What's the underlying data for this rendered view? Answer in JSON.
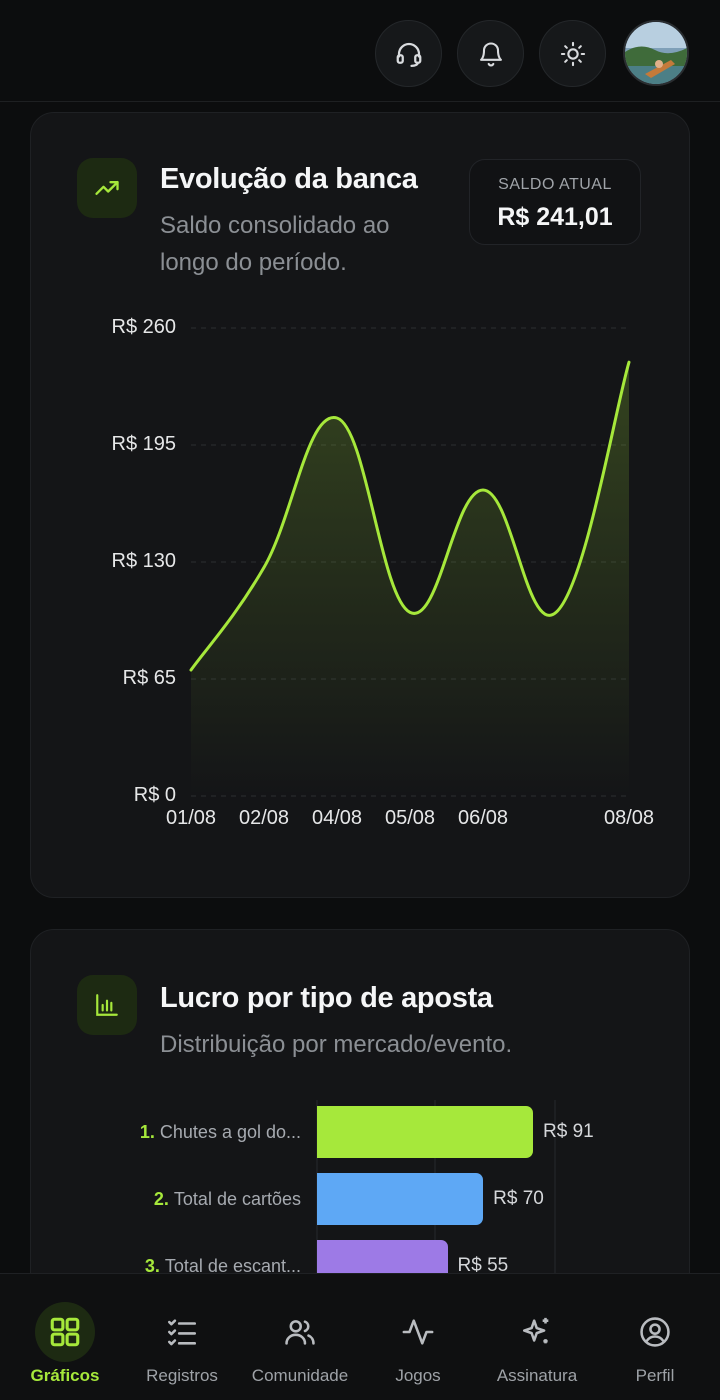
{
  "header": {
    "buttons": [
      {
        "icon": "headset-icon"
      },
      {
        "icon": "bell-icon"
      },
      {
        "icon": "sun-icon"
      }
    ],
    "avatar_icon": "avatar"
  },
  "evolution_card": {
    "icon": "trending-up-icon",
    "title": "Evolução da banca",
    "subtitle_line1": "Saldo consolidado ao",
    "subtitle_line2": "longo do período.",
    "balance_label": "SALDO ATUAL",
    "balance_value": "R$ 241,01",
    "accent": "#a6e83b"
  },
  "chart_data": {
    "type": "area",
    "y_tick_labels": [
      "R$ 260",
      "R$ 195",
      "R$ 130",
      "R$ 65",
      "R$ 0"
    ],
    "y_ticks": [
      260,
      195,
      130,
      65,
      0
    ],
    "ylim": [
      0,
      260
    ],
    "x_tick_labels": [
      "01/08",
      "02/08",
      "04/08",
      "05/08",
      "06/08",
      "08/08"
    ],
    "x_tick_index": [
      0,
      1,
      2,
      3,
      4,
      6
    ],
    "x": [
      "01/08",
      "02/08",
      "04/08",
      "05/08",
      "06/08",
      "07/08",
      "08/08"
    ],
    "values": [
      70,
      127,
      210,
      102,
      170,
      102,
      241
    ],
    "grid": true,
    "line_color": "#a6e83b"
  },
  "profit_card": {
    "icon": "bar-chart-icon",
    "title": "Lucro por tipo de aposta",
    "subtitle": "Distribuição por mercado/evento.",
    "items": [
      {
        "rank": "1.",
        "label": "Chutes a gol do...",
        "value": 91,
        "value_label": "R$ 91",
        "color": "#a6e83b"
      },
      {
        "rank": "2.",
        "label": "Total de cartões",
        "value": 70,
        "value_label": "R$ 70",
        "color": "#5ea8f5"
      },
      {
        "rank": "3.",
        "label": "Total de escant...",
        "value": 55,
        "value_label": "R$ 55",
        "color": "#9d7ae6"
      }
    ]
  },
  "bottom_nav": {
    "items": [
      {
        "label": "Gráficos",
        "icon": "grid-icon",
        "active": true
      },
      {
        "label": "Registros",
        "icon": "checklist-icon",
        "active": false
      },
      {
        "label": "Comunidade",
        "icon": "users-icon",
        "active": false
      },
      {
        "label": "Jogos",
        "icon": "activity-icon",
        "active": false
      },
      {
        "label": "Assinatura",
        "icon": "sparkles-icon",
        "active": false
      },
      {
        "label": "Perfil",
        "icon": "user-circle-icon",
        "active": false
      }
    ]
  }
}
